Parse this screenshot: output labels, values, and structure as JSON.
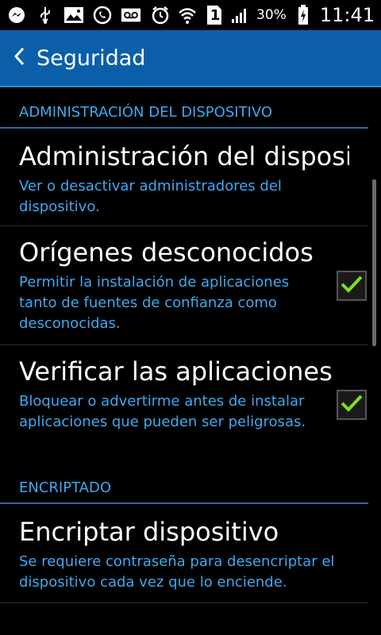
{
  "status_bar": {
    "signal_label": "1",
    "battery_percent": "30%",
    "time": "11:41",
    "icons": [
      "messenger-icon",
      "usb-icon",
      "image-icon",
      "whatsapp-icon",
      "voicemail-icon",
      "alarm-icon",
      "wifi-icon",
      "sim-icon",
      "signal-icon",
      "battery-icon"
    ]
  },
  "header": {
    "title": "Seguridad"
  },
  "sections": [
    {
      "header": "ADMINISTRACIÓN DEL DISPOSITIVO",
      "items": [
        {
          "title": "Administración del disposit..",
          "subtitle": "Ver o desactivar administradores del dispositivo."
        },
        {
          "title": "Orígenes desconocidos",
          "subtitle": "Permitir la instalación de aplicaciones tanto de fuentes de confianza como desconocidas.",
          "checked": true
        },
        {
          "title": "Verificar las aplicaciones",
          "subtitle": "Bloquear o advertirme antes de instalar aplicaciones que pueden ser peligrosas.",
          "checked": true
        }
      ]
    },
    {
      "header": "ENCRIPTADO",
      "items": [
        {
          "title": "Encriptar dispositivo",
          "subtitle": "Se requiere contraseña para desencriptar el dispositivo cada vez que lo enciende."
        }
      ]
    }
  ],
  "colors": {
    "appbar": "#0b5fa8",
    "accent": "#3fa8f0",
    "check": "#7ee01a"
  }
}
